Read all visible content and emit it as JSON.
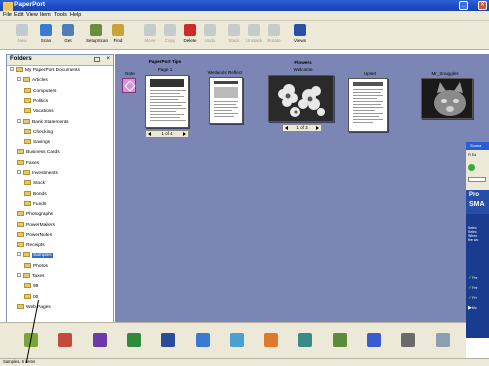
{
  "window": {
    "title": "PaperPort"
  },
  "menu": [
    "File",
    "Edit",
    "View",
    "Item",
    "Tools",
    "Help"
  ],
  "toolbar": [
    {
      "label": "New",
      "color": "#8fa8c8",
      "enabled": false
    },
    {
      "label": "Scan",
      "color": "#3a7bd5",
      "enabled": true
    },
    {
      "label": "Get",
      "color": "#4f7fb8",
      "enabled": true
    },
    {
      "label": "SetupScan",
      "color": "#6b8e3a",
      "enabled": true
    },
    {
      "label": "Find",
      "color": "#c9a23a",
      "enabled": true
    },
    {
      "label": "Move",
      "color": "#9aa8b8",
      "enabled": false
    },
    {
      "label": "Copy",
      "color": "#9aa8b8",
      "enabled": false
    },
    {
      "label": "Delete",
      "color": "#cc2b2b",
      "enabled": true
    },
    {
      "label": "Undo",
      "color": "#9aa8b8",
      "enabled": false
    },
    {
      "label": "Stack",
      "color": "#9aa8b8",
      "enabled": false
    },
    {
      "label": "Unstack",
      "color": "#9aa8b8",
      "enabled": false
    },
    {
      "label": "Rotate",
      "color": "#9aa8b8",
      "enabled": false
    },
    {
      "label": "Views",
      "color": "#2b4fa8",
      "enabled": true
    }
  ],
  "folders": {
    "title": "Folders",
    "close": "×",
    "tree": [
      {
        "label": "My PaperPort Documents",
        "level": 0,
        "expander": true
      },
      {
        "label": "Articles",
        "level": 1,
        "expander": true
      },
      {
        "label": "Computers",
        "level": 2
      },
      {
        "label": "Politics",
        "level": 2
      },
      {
        "label": "Vacations",
        "level": 2
      },
      {
        "label": "Bank Statements",
        "level": 1,
        "expander": true
      },
      {
        "label": "Checking",
        "level": 2
      },
      {
        "label": "Savings",
        "level": 2
      },
      {
        "label": "Business Cards",
        "level": 1
      },
      {
        "label": "Faxes",
        "level": 1
      },
      {
        "label": "Investments",
        "level": 1,
        "expander": true
      },
      {
        "label": "Stock",
        "level": 2
      },
      {
        "label": "Bonds",
        "level": 2
      },
      {
        "label": "Funds",
        "level": 2
      },
      {
        "label": "Photographs",
        "level": 1
      },
      {
        "label": "PowerMailers",
        "level": 1
      },
      {
        "label": "PowerNotes",
        "level": 1
      },
      {
        "label": "Receipts",
        "level": 1
      },
      {
        "label": "Samples",
        "level": 1,
        "expander": true,
        "selected": true
      },
      {
        "label": "Photos",
        "level": 2
      },
      {
        "label": "Taxes",
        "level": 1,
        "expander": true
      },
      {
        "label": "99",
        "level": 2
      },
      {
        "label": "00",
        "level": 2
      },
      {
        "label": "Web Pages",
        "level": 1
      }
    ]
  },
  "thumbnails": [
    {
      "caption": "Note",
      "caption2": "",
      "kind": "note"
    },
    {
      "caption": "PaperPort Tips",
      "caption2": "Page 1",
      "kind": "doc",
      "pager": "1 of 4"
    },
    {
      "caption": "",
      "caption2": "Wetlands Reflect",
      "kind": "doc2"
    },
    {
      "caption": "Flowers",
      "caption2": "Welcome",
      "kind": "photo",
      "pager": "1 of 3"
    },
    {
      "caption": "",
      "caption2": "Upset",
      "kind": "doc3"
    },
    {
      "caption": "",
      "caption2": "Mr_Snuggles",
      "kind": "cat"
    }
  ],
  "sidepanel": {
    "title": "Scana",
    "big_text_1": "Pro",
    "big_text_2": "SMA",
    "check_items": [
      "Fre",
      "Fre",
      "Pri",
      "Mo"
    ]
  },
  "bottombar": {
    "items": [
      {
        "name": "send-to-paperport-icon",
        "color": "#7aa638"
      },
      {
        "name": "recycle-icon",
        "color": "#c44a3a"
      },
      {
        "name": "color-app-icon",
        "color": "#6a3aa8"
      },
      {
        "name": "excel-icon",
        "color": "#2f8a3a"
      },
      {
        "name": "scan-app-icon",
        "color": "#2a4a9a"
      },
      {
        "name": "note-edit-icon",
        "color": "#3a7ad0"
      },
      {
        "name": "word-icon",
        "color": "#4aa0d0"
      },
      {
        "name": "image-editor-icon",
        "color": "#e07a2a"
      },
      {
        "name": "globe-icon",
        "color": "#3a8a8a"
      },
      {
        "name": "fax-icon",
        "color": "#5a8a3a"
      },
      {
        "name": "ocr-icon",
        "color": "#3a5ad0"
      },
      {
        "name": "printer-icon",
        "color": "#6a6a6a"
      },
      {
        "name": "mail-icon",
        "color": "#8aa0b0"
      }
    ]
  },
  "status": "Samples, 6 items"
}
